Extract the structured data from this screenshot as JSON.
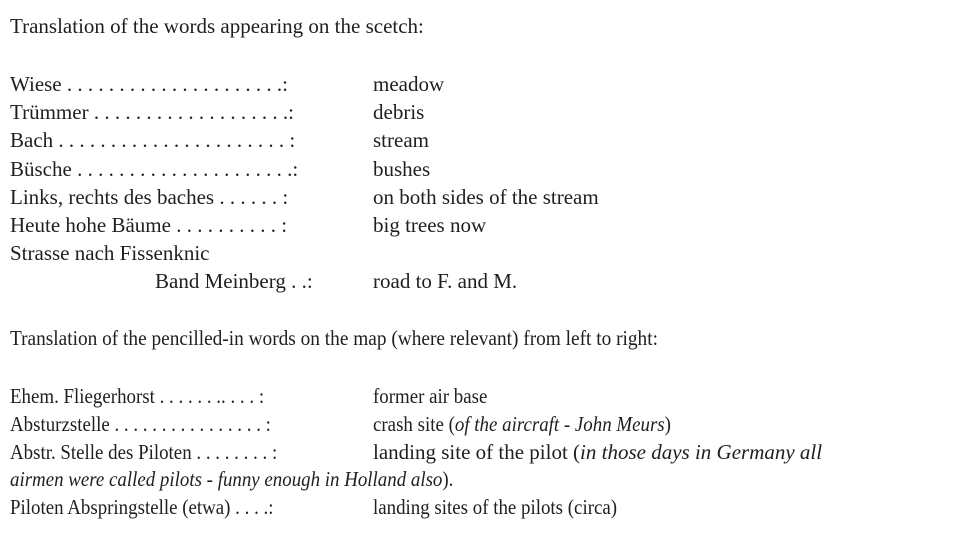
{
  "section1": {
    "heading": "Translation of the words appearing on the scetch:",
    "entries": [
      {
        "term": "Wiese . . . . . . . . . . . . . . . . . . . . .:",
        "definition": "meadow"
      },
      {
        "term": "Trümmer . . . . . . . . . . . . . . . . . . .:",
        "definition": "debris"
      },
      {
        "term": "Bach . . . . . . . . . . . . . . . . . . . . . . :",
        "definition": "stream"
      },
      {
        "term": "Büsche . . . . . . . . . . . . . . . . . . . . .:",
        "definition": "bushes"
      },
      {
        "term": "Links, rechts des baches . . . . . . :",
        "definition": "on both sides of the stream"
      },
      {
        "term": "Heute hohe Bäume . . . . . . . . . . :",
        "definition": "big trees now"
      },
      {
        "term": "Strasse nach Fissenknic",
        "definition": ""
      },
      {
        "term": "Band Meinberg . .:",
        "definition": "road to F. and M."
      }
    ]
  },
  "section2": {
    "heading": "Translation of the pencilled-in words on the map (where relevant) from left to right:",
    "entries": [
      {
        "term": "Ehem. Fliegerhorst . . . . . . .. . . . :",
        "definition": "former air base",
        "note": ""
      },
      {
        "term": "Absturzstelle . . . . . . . . . . . . . . . . :",
        "definition": "crash site (",
        "note": "of the aircraft - John Meurs",
        "tail": ")"
      },
      {
        "term": "Abstr. Stelle des Piloten . . . . . . . . :",
        "definition": "landing site of the pilot (",
        "note": "in those days in Germany all"
      },
      {
        "continuation_note": "airmen were called pilots - funny enough in Holland also",
        "continuation_tail": ")."
      },
      {
        "term": "Piloten Abspringstelle (etwa) . . . .:",
        "definition": "landing sites of the pilots (circa)"
      }
    ]
  }
}
